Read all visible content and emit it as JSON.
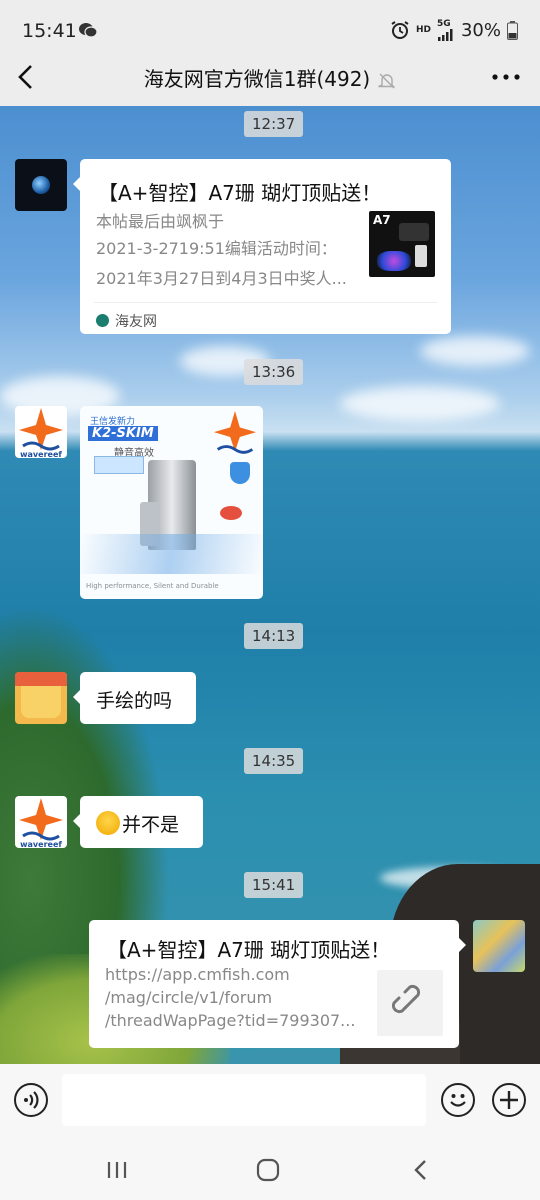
{
  "status_bar": {
    "time": "15:41",
    "battery": "30%",
    "hd": "HD",
    "network": "5G"
  },
  "header": {
    "title": "海友网官方微信1群(492)"
  },
  "messages": {
    "ts1": "12:37",
    "card1": {
      "title": "【A+智控】A7珊 瑚灯顶贴送！",
      "desc_line1": "本帖最后由飒枫于",
      "desc_line2": "2021-3-2719:51编辑活动时间：",
      "desc_line3": "2021年3月27日到4月3日中奖人...",
      "source": "海友网",
      "thumb_text": "A7"
    },
    "ts2": "13:36",
    "image": {
      "line1": "王信发新力",
      "product": "K2-SKIM",
      "line2": "静音高效",
      "footer": "High performance, Silent and Durable"
    },
    "ts3": "14:13",
    "text1": "手绘的吗",
    "ts4": "14:35",
    "text2": "并不是",
    "ts5": "15:41",
    "card2": {
      "title": "【A+智控】A7珊 瑚灯顶贴送！",
      "url_line1": "https://app.cmfish.com",
      "url_line2": "/mag/circle/v1/forum",
      "url_line3": "/threadWapPage?tid=799307..."
    },
    "wavereef_label": "wavereef"
  },
  "colors": {
    "bar_bg": "#ededed",
    "bubble": "#ffffff",
    "wavereef_orange": "#f26b1d",
    "wavereef_blue": "#1e4fa0"
  },
  "icons": [
    "back-arrow-icon",
    "mute-bell-icon",
    "more-icon",
    "voice-icon",
    "emoji-icon",
    "plus-icon",
    "link-icon",
    "recents-icon",
    "home-icon",
    "back-icon"
  ]
}
